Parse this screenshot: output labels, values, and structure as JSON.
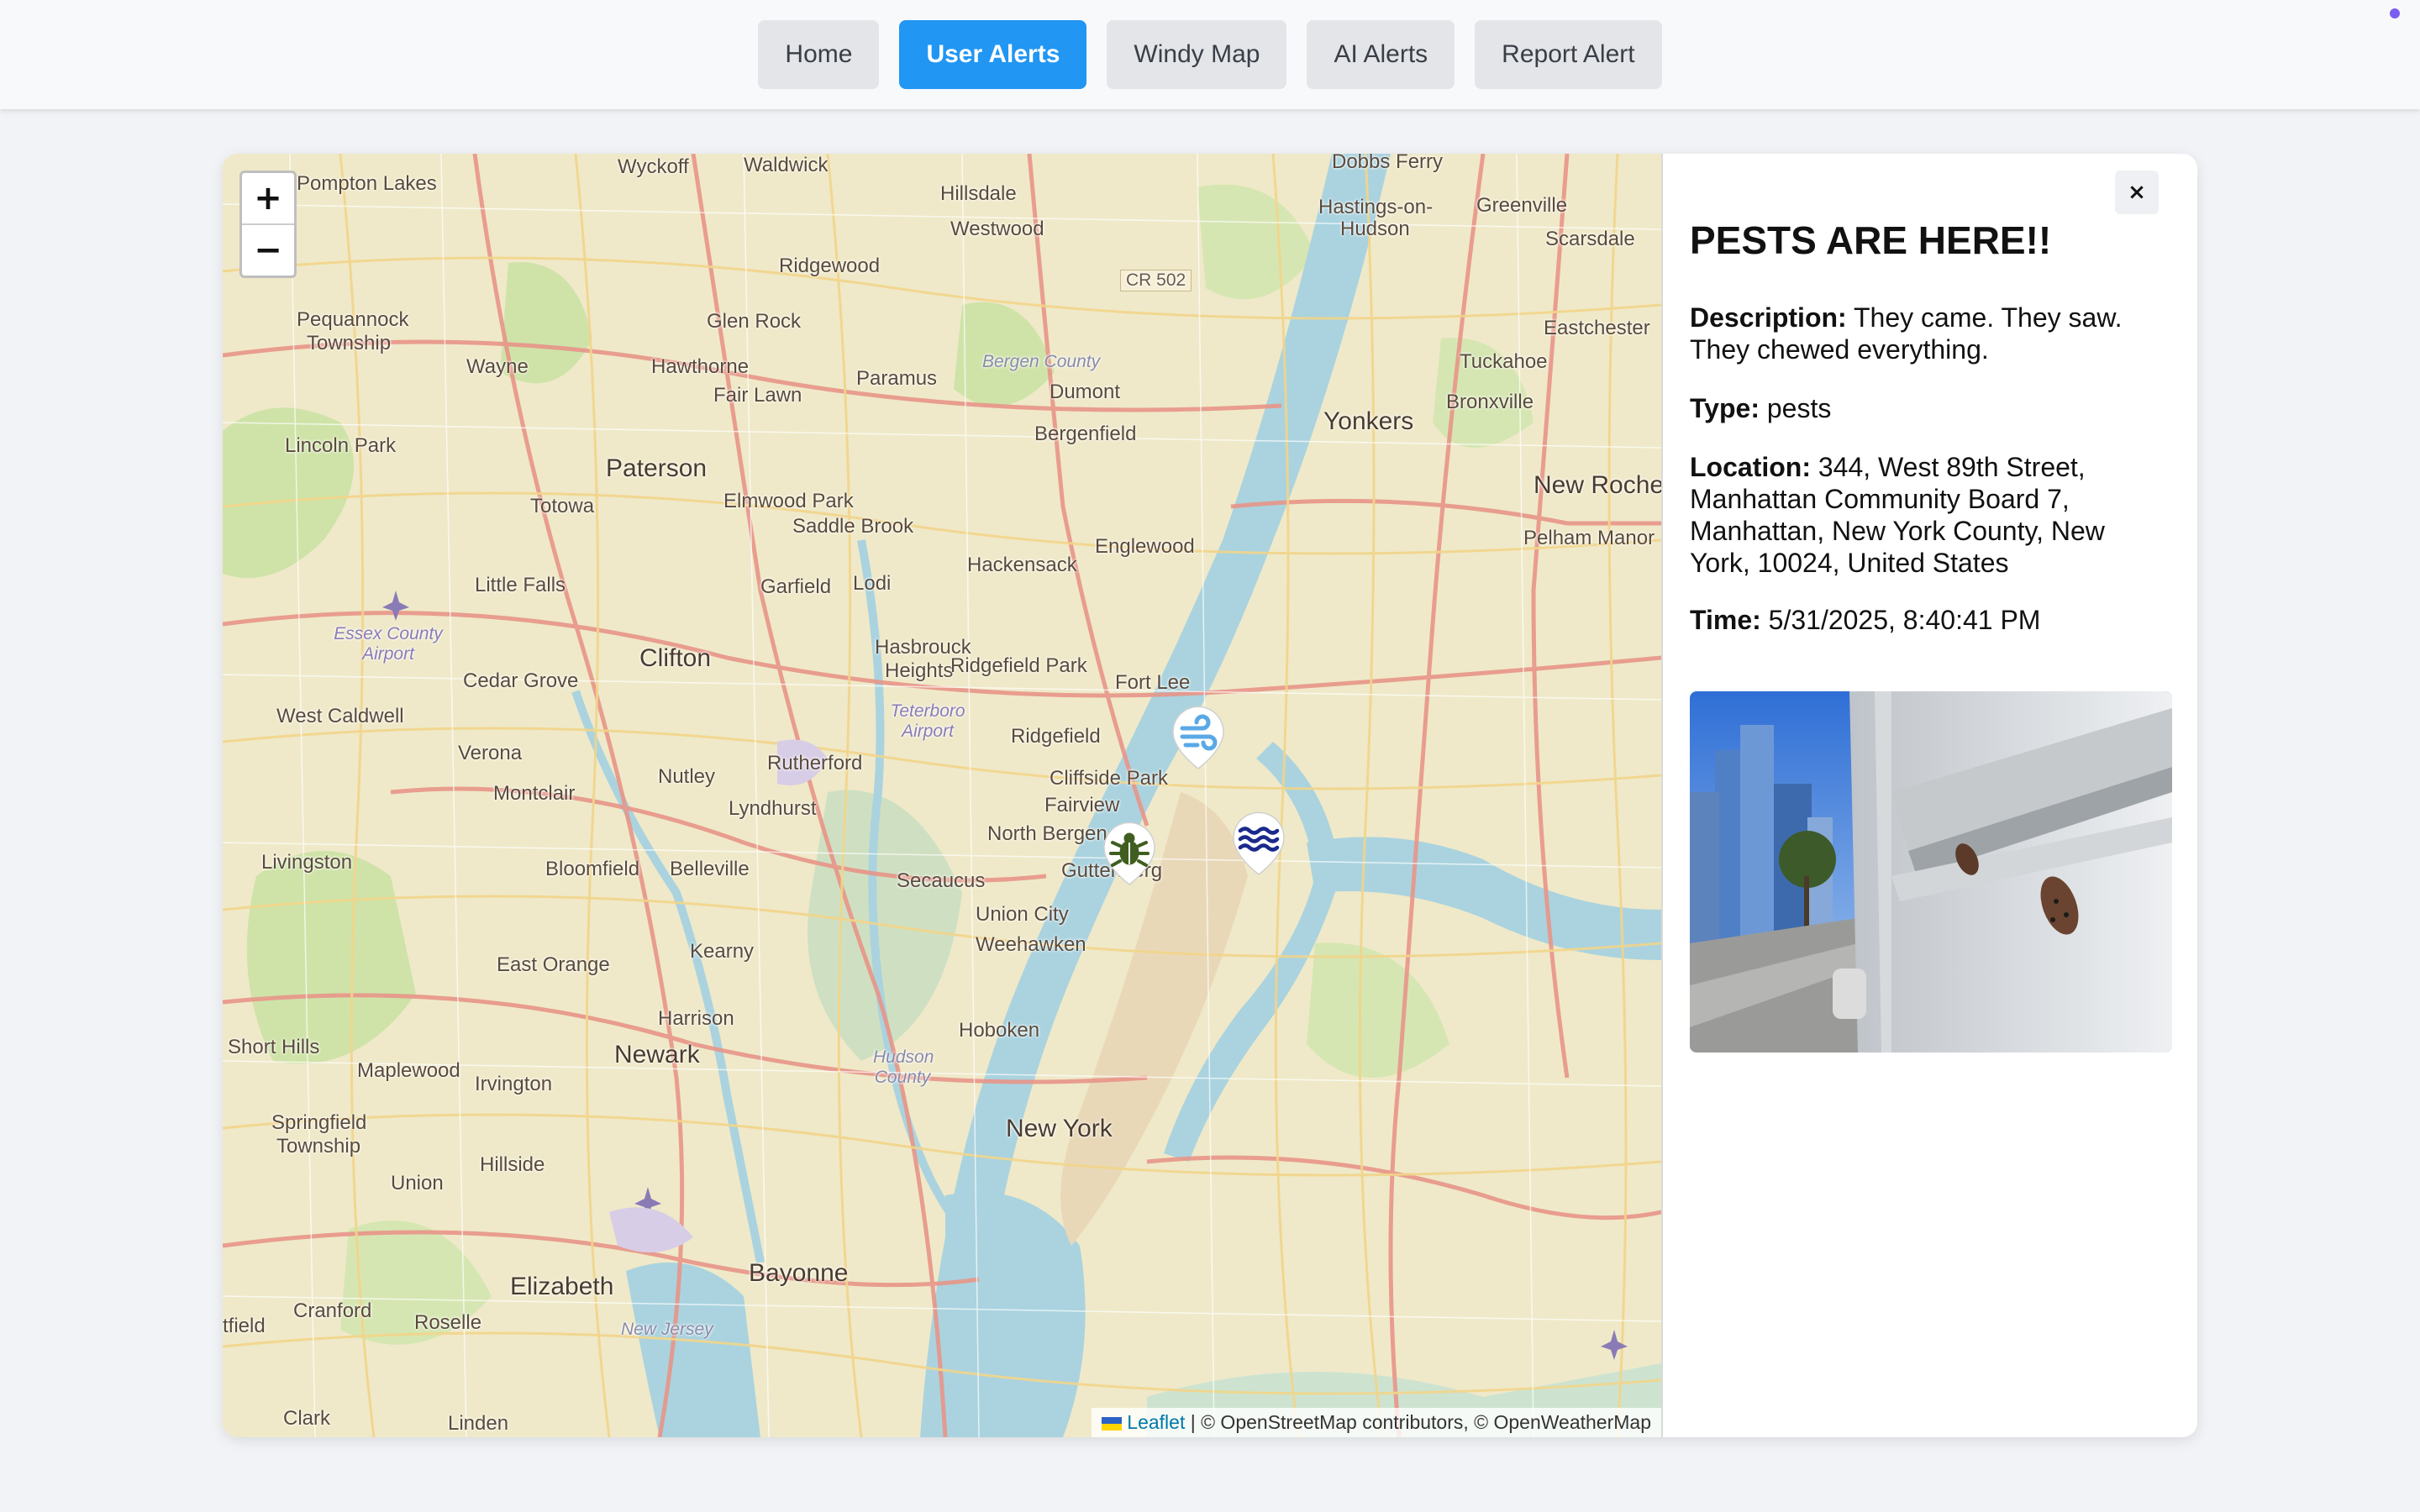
{
  "nav": {
    "items": [
      {
        "label": "Home",
        "active": false
      },
      {
        "label": "User Alerts",
        "active": true
      },
      {
        "label": "Windy Map",
        "active": false
      },
      {
        "label": "AI Alerts",
        "active": false
      },
      {
        "label": "Report Alert",
        "active": false
      }
    ]
  },
  "map": {
    "zoom_in": "+",
    "zoom_out": "−",
    "labels": {
      "wyckoff": "Wyckoff",
      "waldwick": "Waldwick",
      "pompton_lakes": "Pompton Lakes",
      "hillsdale": "Hillsdale",
      "westwood": "Westwood",
      "hastings": "Hastings-on-",
      "hudson": "Hudson",
      "greenville": "Greenville",
      "scarsdale": "Scarsdale",
      "ridgewood": "Ridgewood",
      "pequannock": "Pequannock",
      "township": "Township",
      "glen_rock": "Glen Rock",
      "wayne": "Wayne",
      "hawthorne": "Hawthorne",
      "paramus": "Paramus",
      "bergen_county": "Bergen County",
      "dumont": "Dumont",
      "eastchester": "Eastchester",
      "tuckahoe": "Tuckahoe",
      "fair_lawn": "Fair Lawn",
      "bronxville": "Bronxville",
      "yonkers": "Yonkers",
      "lincoln_park": "Lincoln Park",
      "bergenfield": "Bergenfield",
      "paterson": "Paterson",
      "new_rochelle": "New Rochel",
      "totowa": "Totowa",
      "elmwood_park": "Elmwood Park",
      "saddle_brook": "Saddle Brook",
      "englewood": "Englewood",
      "pelham_manor": "Pelham Manor",
      "little_falls": "Little Falls",
      "garfield": "Garfield",
      "lodi": "Lodi",
      "hackensack": "Hackensack",
      "essex_airport": "Essex County Airport",
      "clifton": "Clifton",
      "hasbrouck": "Hasbrouck",
      "heights": "Heights",
      "ridgefield_park": "Ridgefield Park",
      "fort_lee": "Fort Lee",
      "cedar_grove": "Cedar Grove",
      "west_caldwell": "West Caldwell",
      "teterboro": "Teterboro Airport",
      "ridgefield": "Ridgefield",
      "verona": "Verona",
      "rutherford": "Rutherford",
      "nutley": "Nutley",
      "cliffside": "Cliffside Park",
      "montclair": "Montclair",
      "fairview": "Fairview",
      "lyndhurst": "Lyndhurst",
      "north_bergen": "North Bergen",
      "livingston": "Livingston",
      "guttenberg": "Guttenberg",
      "bloomfield": "Bloomfield",
      "belleville": "Belleville",
      "secaucus": "Secaucus",
      "union_city": "Union City",
      "weehawken": "Weehawken",
      "kearny": "Kearny",
      "east_orange": "East Orange",
      "harrison": "Harrison",
      "hoboken": "Hoboken",
      "short_hills": "Short Hills",
      "newark": "Newark",
      "maplewood": "Maplewood",
      "irvington": "Irvington",
      "hudson_county": "Hudson County",
      "springfield": "Springfield",
      "springfield_twp": "Township",
      "new_york": "New York",
      "hillside": "Hillside",
      "union": "Union",
      "bayonne": "Bayonne",
      "elizabeth": "Elizabeth",
      "cranford": "Cranford",
      "roselle": "Roselle",
      "field": "tfield",
      "new_jersey": "New Jersey",
      "clark": "Clark",
      "linden": "Linden",
      "cr502": "CR 502",
      "dobbs_ferry": "Dobbs Ferry",
      "new_york_river": "New York"
    },
    "attribution": {
      "leaflet": "Leaflet",
      "rest": " | © OpenStreetMap contributors, © OpenWeatherMap"
    },
    "markers": [
      {
        "name": "wind-alert-marker",
        "icon": "wind-icon",
        "color": "#5aa9e6"
      },
      {
        "name": "pests-alert-marker",
        "icon": "bug-icon",
        "color": "#3f5e1f"
      },
      {
        "name": "flood-alert-marker",
        "icon": "water-waves-icon",
        "color": "#1a2a8c"
      }
    ]
  },
  "panel": {
    "close": "×",
    "title": "PESTS ARE HERE!!",
    "description_label": "Description:",
    "description": " They came. They saw. They chewed everything.",
    "type_label": "Type:",
    "type": " pests",
    "location_label": "Location:",
    "location": " 344, West 89th Street, Manhattan Community Board 7, Manhattan, New York County, New York, 10024, United States",
    "time_label": "Time:",
    "time": " 5/31/2025, 8:40:41 PM"
  }
}
